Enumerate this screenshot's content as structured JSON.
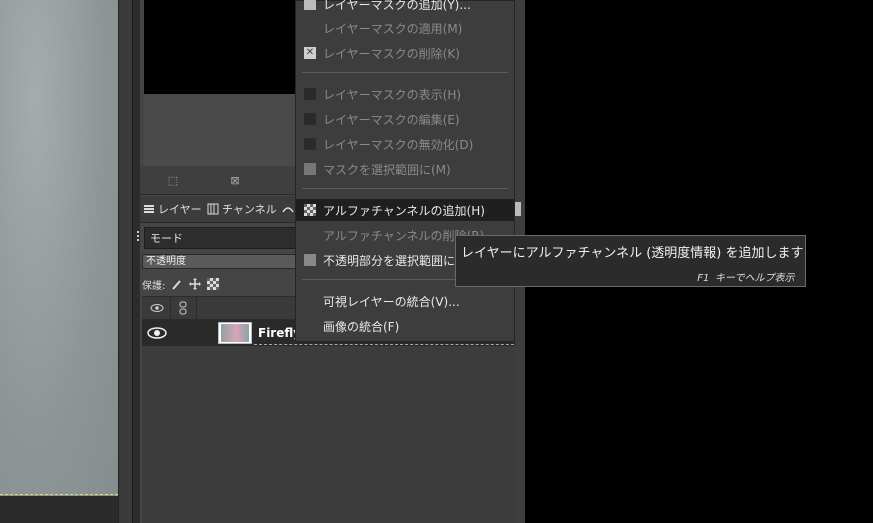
{
  "panel": {
    "tabs": [
      {
        "label": "レイヤー"
      },
      {
        "label": "チャンネル"
      }
    ],
    "mode_label": "モード",
    "opacity_label": "不透明度",
    "lock_label": "保護:",
    "layer_name": "Firefly"
  },
  "menu": {
    "items": [
      {
        "label": "レイヤーマスクの追加(Y)...",
        "disabled": false
      },
      {
        "label": "レイヤーマスクの適用(M)",
        "disabled": true
      },
      {
        "label": "レイヤーマスクの削除(K)",
        "disabled": true
      },
      {
        "label": "レイヤーマスクの表示(H)",
        "disabled": true
      },
      {
        "label": "レイヤーマスクの編集(E)",
        "disabled": true
      },
      {
        "label": "レイヤーマスクの無効化(D)",
        "disabled": true
      },
      {
        "label": "マスクを選択範囲に(M)",
        "disabled": true
      },
      {
        "label": "アルファチャンネルの追加(H)",
        "disabled": false,
        "highlighted": true
      },
      {
        "label": "アルファチャンネルの削除(R)",
        "disabled": true
      },
      {
        "label": "不透明部分を選択範囲に(H)",
        "disabled": false
      },
      {
        "label": "可視レイヤーの統合(V)...",
        "disabled": false
      },
      {
        "label": "画像の統合(F)",
        "disabled": false
      }
    ]
  },
  "tooltip": {
    "text": "レイヤーにアルファチャンネル (透明度情報) を追加します",
    "hint_key": "F1",
    "hint_text": "キーでヘルプ表示"
  },
  "icons": {
    "layers_tab": "layers-icon",
    "channels_tab": "channels-icon",
    "eye": "eye-icon",
    "chain": "chain-icon"
  }
}
